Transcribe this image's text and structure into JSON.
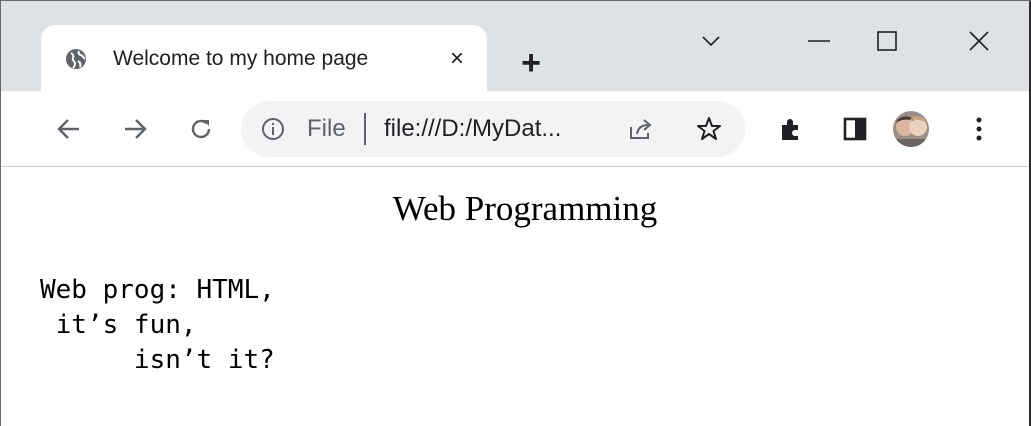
{
  "tab": {
    "title": "Welcome to my home page",
    "close_label": "×",
    "new_tab_label": "+"
  },
  "omnibox": {
    "scheme_label": "File",
    "url": "file:///D:/MyDat..."
  },
  "page": {
    "heading": "Web Programming",
    "preformatted": "Web prog: HTML,\n it’s fun,\n      isn’t it?"
  },
  "colors": {
    "tabstrip_bg": "#dee1e6",
    "omnibox_bg": "#f1f3f4",
    "icon": "#5f6368",
    "text": "#202124"
  }
}
